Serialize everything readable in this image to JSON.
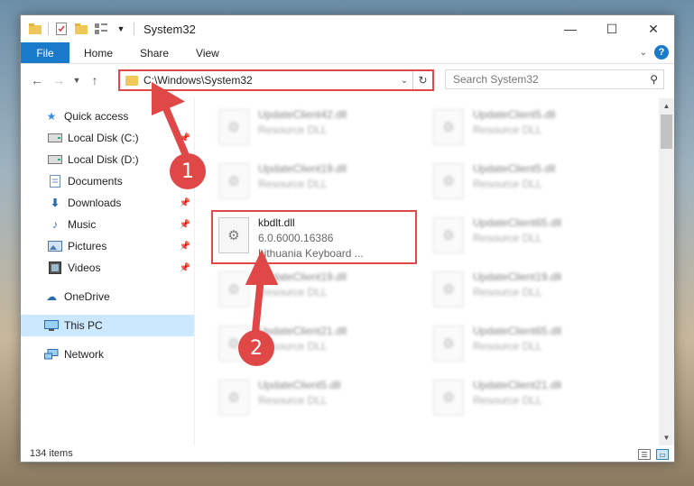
{
  "window": {
    "title": "System32",
    "minimize": "—",
    "maximize": "☐",
    "close": "✕"
  },
  "ribbon": {
    "tabs": [
      "File",
      "Home",
      "Share",
      "View"
    ]
  },
  "address": {
    "path": "C:\\Windows\\System32"
  },
  "search": {
    "placeholder": "Search System32"
  },
  "sidebar": {
    "items": [
      {
        "label": "Quick access",
        "icon": "star-icon"
      },
      {
        "label": "Local Disk (C:)",
        "icon": "drive-icon"
      },
      {
        "label": "Local Disk (D:)",
        "icon": "drive-icon"
      },
      {
        "label": "Documents",
        "icon": "documents-icon"
      },
      {
        "label": "Downloads",
        "icon": "download-icon"
      },
      {
        "label": "Music",
        "icon": "music-icon"
      },
      {
        "label": "Pictures",
        "icon": "pictures-icon"
      },
      {
        "label": "Videos",
        "icon": "videos-icon"
      },
      {
        "label": "OneDrive",
        "icon": "cloud-icon"
      },
      {
        "label": "This PC",
        "icon": "computer-icon"
      },
      {
        "label": "Network",
        "icon": "network-icon"
      }
    ]
  },
  "files": [
    {
      "name": "UpdateClient42.dll",
      "sub": "Resource DLL"
    },
    {
      "name": "UpdateClient5.dll",
      "sub": "Resource DLL"
    },
    {
      "name": "UpdateClient19.dll",
      "sub": "Resource DLL"
    },
    {
      "name": "UpdateClient5.dll",
      "sub": "Resource DLL"
    },
    {
      "name": "kbdlt.dll",
      "version": "6.0.6000.16386",
      "desc": "Lithuania Keyboard ..."
    },
    {
      "name": "UpdateClient65.dll",
      "sub": "Resource DLL"
    },
    {
      "name": "UpdateClient19.dll",
      "sub": "Resource DLL"
    },
    {
      "name": "UpdateClient19.dll",
      "sub": "Resource DLL"
    },
    {
      "name": "UpdateClient21.dll",
      "sub": "Resource DLL"
    },
    {
      "name": "UpdateClient65.dll",
      "sub": "Resource DLL"
    },
    {
      "name": "UpdateClient5.dll",
      "sub": "Resource DLL"
    },
    {
      "name": "UpdateClient21.dll",
      "sub": "Resource DLL"
    }
  ],
  "status": {
    "count": "134 items"
  },
  "annotations": {
    "step1": "1",
    "step2": "2",
    "color": "#e04848"
  }
}
